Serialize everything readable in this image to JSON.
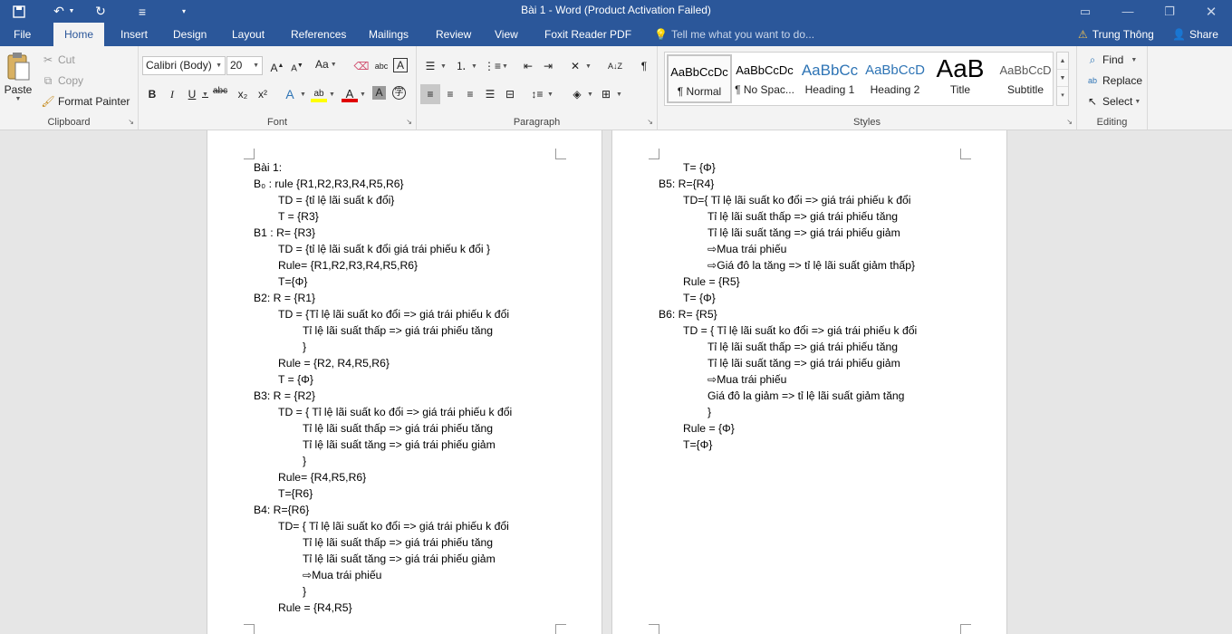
{
  "window": {
    "title": "Bài 1 - Word (Product Activation Failed)",
    "qat_icons": [
      "save-icon",
      "undo-icon",
      "redo-icon",
      "touch-mode-icon",
      "customize-qat-icon"
    ],
    "controls": [
      "ribbon-display-icon",
      "minimize-icon",
      "restore-icon",
      "close-icon"
    ]
  },
  "tabs": {
    "file": "File",
    "home": "Home",
    "insert": "Insert",
    "design": "Design",
    "layout": "Layout",
    "references": "References",
    "mailings": "Mailings",
    "review": "Review",
    "view": "View",
    "foxit": "Foxit Reader PDF",
    "tell_me": "Tell me what you want to do...",
    "user": "Trung Thông",
    "share": "Share"
  },
  "ribbon": {
    "clipboard": {
      "label": "Clipboard",
      "paste": "Paste",
      "cut": "Cut",
      "copy": "Copy",
      "format_painter": "Format Painter"
    },
    "font": {
      "label": "Font",
      "name": "Calibri (Body)",
      "size": "20",
      "bold": "B",
      "italic": "I",
      "underline": "U",
      "strike": "abc",
      "sub": "x₂",
      "sup": "x²",
      "change_case": "Aa"
    },
    "paragraph": {
      "label": "Paragraph"
    },
    "styles": {
      "label": "Styles",
      "items": [
        {
          "preview": "AaBbCcDc",
          "name": "¶ Normal"
        },
        {
          "preview": "AaBbCcDc",
          "name": "¶ No Spac..."
        },
        {
          "preview": "AaBbCc",
          "name": "Heading 1"
        },
        {
          "preview": "AaBbCcD",
          "name": "Heading 2"
        },
        {
          "preview": "AaB",
          "name": "Title"
        },
        {
          "preview": "AaBbCcD",
          "name": "Subtitle"
        }
      ],
      "preview_colors": [
        "#000000",
        "#000000",
        "#2e74b5",
        "#2e74b5",
        "#000000",
        "#595959"
      ]
    },
    "editing": {
      "label": "Editing",
      "find": "Find",
      "replace": "Replace",
      "select": "Select"
    }
  },
  "document": {
    "page1": [
      "Bài 1:",
      "B₀ :  rule {R1,R2,R3,R4,R5,R6}",
      "TD = {tỉ lệ lãi suất k đổi}",
      "T = {R3}",
      "B1 : R= {R3}",
      "TD = {tỉ lệ lãi suất k đổi giá trái phiếu k đổi }",
      "Rule= {R1,R2,R3,R4,R5,R6}",
      "T={Φ}",
      "B2:  R = {R1}",
      "TD = {Tỉ lệ lãi suất ko đổi => giá trái phiếu k đổi",
      "Tỉ lệ lãi suất thấp => giá trái phiếu tăng",
      "}",
      "Rule = {R2, R4,R5,R6}",
      "T = {Φ}",
      "B3:  R = {R2}",
      "TD = { Tỉ lệ lãi suất ko đổi => giá trái phiếu k đổi",
      "Tỉ lệ lãi suất thấp => giá trái phiếu tăng",
      "Tỉ lệ lãi suất tăng => giá trái phiếu giảm",
      "}",
      "Rule= {R4,R5,R6}",
      "T={R6}",
      "B4:  R={R6}",
      "TD= { Tỉ lệ lãi suất ko đổi => giá trái phiếu k đổi",
      "Tỉ lệ lãi suất thấp => giá trái phiếu tăng",
      "Tỉ lệ lãi suất tăng => giá trái phiếu giảm",
      "⇨Mua trái phiếu",
      "}",
      "Rule = {R4,R5}"
    ],
    "page2": [
      "T= {Φ}",
      "B5:  R={R4}",
      "TD={ Tỉ lệ lãi suất ko đổi => giá trái phiếu k đổi",
      "Tỉ lệ lãi suất thấp => giá trái phiếu tăng",
      "Tỉ lệ lãi suất tăng => giá trái phiếu giảm",
      "⇨Mua trái phiếu",
      "⇨Giá đô la tăng => tỉ lệ lãi suất giảm thấp}",
      "Rule = {R5}",
      "T= {Φ}",
      "B6:  R= {R5}",
      "TD = { Tỉ lệ lãi suất ko đổi => giá trái phiếu k đổi",
      "Tỉ lệ lãi suất thấp => giá trái phiếu tăng",
      "Tỉ lệ lãi suất tăng => giá trái phiếu giảm",
      "⇨Mua trái phiếu",
      "Giá đô la giảm => tỉ lệ lãi suất giảm tăng",
      "}",
      "Rule = {Φ}",
      "T={Φ}"
    ]
  }
}
